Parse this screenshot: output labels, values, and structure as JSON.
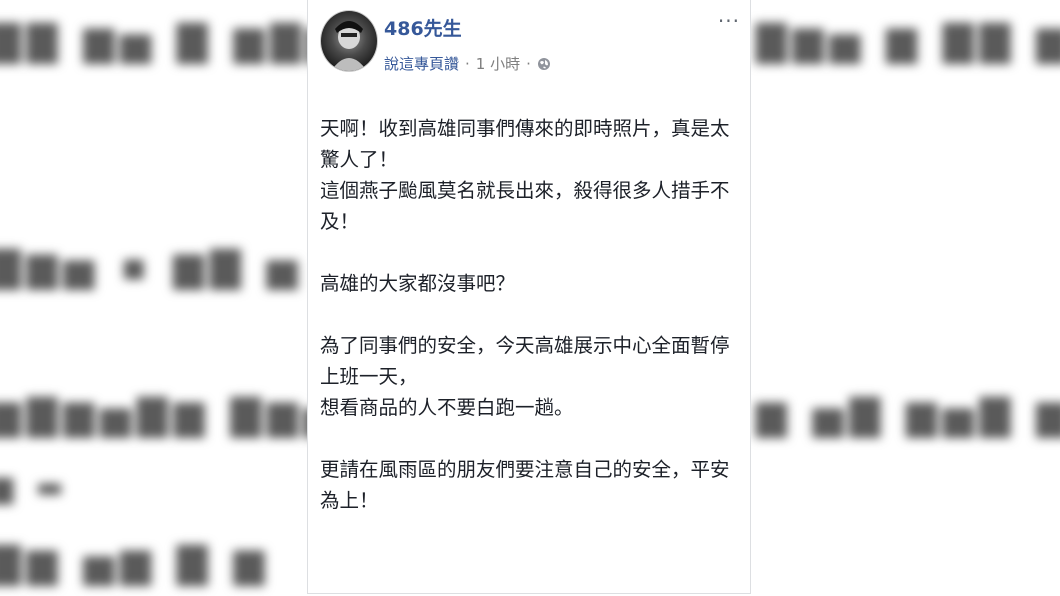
{
  "background": {
    "rows": [
      "",
      "",
      "",
      "",
      ""
    ]
  },
  "post": {
    "author": "486先生",
    "source_label": "說這專頁讚",
    "separator": "·",
    "time": "1 小時",
    "more": "···",
    "paragraphs": [
      [
        "天啊！收到高雄同事們傳來的即時照片，真是太",
        "驚人了！",
        "這個燕子颱風莫名就長出來，殺得很多人措手不",
        "及！"
      ],
      [
        "高雄的大家都沒事吧？"
      ],
      [
        "為了同事們的安全，今天高雄展示中心全面暫停",
        "上班一天，",
        "想看商品的人不要白跑一趟。"
      ],
      [
        "更請在風雨區的朋友們要注意自己的安全，平安",
        "為上！"
      ]
    ]
  },
  "colors": {
    "link": "#365899",
    "text": "#1d2129",
    "muted": "#7f7f7f"
  }
}
